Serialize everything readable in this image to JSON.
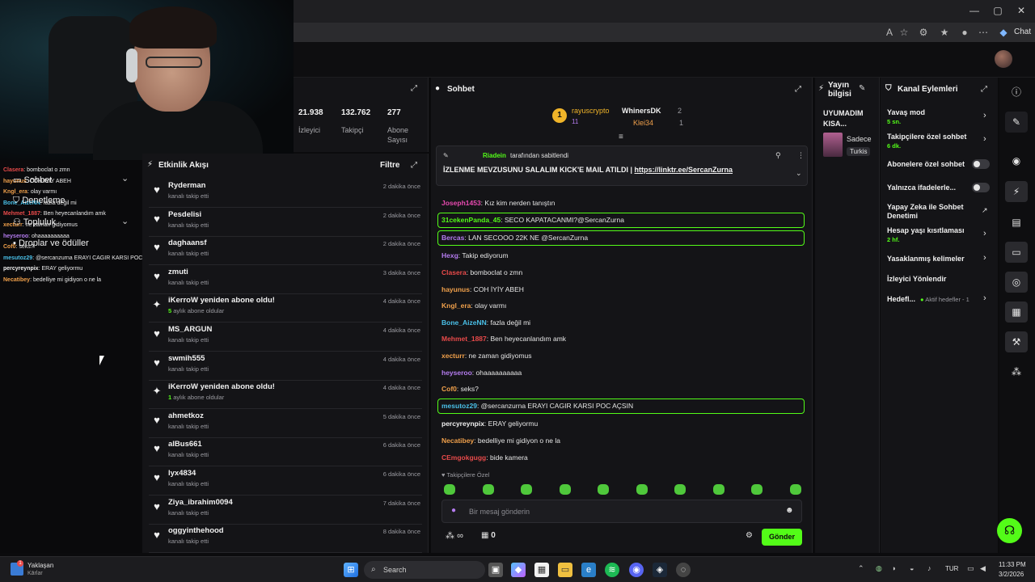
{
  "browser": {
    "copilot": "Chat",
    "window_controls": [
      "—",
      "▢",
      "✕"
    ]
  },
  "left_overlay": {
    "chat": [
      {
        "nick": "Clasera",
        "text": ": bomboclat o zmn",
        "color": "#e84a4a"
      },
      {
        "nick": "hayunus",
        "text": ": COH IYIY ABEH",
        "color": "#f0a04b"
      },
      {
        "nick": "Kngl_era",
        "text": ": olay varmı",
        "color": "#f0a04b"
      },
      {
        "nick": "Bone_AizeNN",
        "text": ": fazla değil mi",
        "color": "#4ac0e8"
      },
      {
        "nick": "Mehmet_1887",
        "text": ": Ben heyecanlandım amk",
        "color": "#e84a4a"
      },
      {
        "nick": "xecturr",
        "text": ": ne zaman gidiyomus",
        "color": "#f0a04b"
      },
      {
        "nick": "heyseroo",
        "text": ": ohaaaaaaaaaa",
        "color": "#b57cf0"
      },
      {
        "nick": "Cof0",
        "text": ": seks?",
        "color": "#f0a04b"
      },
      {
        "nick": "mesutoz29",
        "text": ": @sercanzurna ERAYI CAGIR KARSI POC AÇSIN",
        "color": "#4ac0e8"
      },
      {
        "nick": "percyreynpix",
        "text": ": ERAY geliyormu",
        "color": "#f0f0f0"
      },
      {
        "nick": "Necatibey",
        "text": ": bedelliye mi gidiyon o ne la",
        "color": "#f0a04b"
      }
    ],
    "nav": {
      "item1": "Sohbet",
      "item2": "Denetleme",
      "item3": "Topluluk",
      "item4": "Droplar ve ödüller"
    }
  },
  "stats": {
    "viewers_value": "21.938",
    "viewers_label": "İzleyici",
    "followers_value": "132.762",
    "followers_label": "Takipçi",
    "subs_value": "277",
    "subs_label": "Abone Sayısı"
  },
  "activity": {
    "title": "Etkinlik Akışı",
    "filter": "Filtre",
    "rows": [
      {
        "icon": "heart-icon",
        "glyph": "♥",
        "name": "Ryderman",
        "sub": "kanalı takip etti",
        "bold": "",
        "time": "2 dakika önce"
      },
      {
        "icon": "heart-icon",
        "glyph": "♥",
        "name": "Pesdelisi",
        "sub": "kanalı takip etti",
        "bold": "",
        "time": "2 dakika önce"
      },
      {
        "icon": "heart-icon",
        "glyph": "♥",
        "name": "daghaansf",
        "sub": "kanalı takip etti",
        "bold": "",
        "time": "2 dakika önce"
      },
      {
        "icon": "heart-icon",
        "glyph": "♥",
        "name": "zmuti",
        "sub": "kanalı takip etti",
        "bold": "",
        "time": "3 dakika önce"
      },
      {
        "icon": "sparkle-icon",
        "glyph": "✦",
        "name": "iKerroW yeniden abone oldu!",
        "sub": " aylık abone oldular",
        "bold": "5",
        "time": "4 dakika önce"
      },
      {
        "icon": "heart-icon",
        "glyph": "♥",
        "name": "MS_ARGUN",
        "sub": "kanalı takip etti",
        "bold": "",
        "time": "4 dakika önce"
      },
      {
        "icon": "heart-icon",
        "glyph": "♥",
        "name": "swmih555",
        "sub": "kanalı takip etti",
        "bold": "",
        "time": "4 dakika önce"
      },
      {
        "icon": "sparkle-icon",
        "glyph": "✦",
        "name": "iKerroW yeniden abone oldu!",
        "sub": " aylık abone oldular",
        "bold": "1",
        "time": "4 dakika önce"
      },
      {
        "icon": "heart-icon",
        "glyph": "♥",
        "name": "ahmetkoz",
        "sub": "kanalı takip etti",
        "bold": "",
        "time": "5 dakika önce"
      },
      {
        "icon": "heart-icon",
        "glyph": "♥",
        "name": "alBus661",
        "sub": "kanalı takip etti",
        "bold": "",
        "time": "6 dakika önce"
      },
      {
        "icon": "heart-icon",
        "glyph": "♥",
        "name": "lyx4834",
        "sub": "kanalı takip etti",
        "bold": "",
        "time": "6 dakika önce"
      },
      {
        "icon": "heart-icon",
        "glyph": "♥",
        "name": "Ziya_ibrahim0094",
        "sub": "kanalı takip etti",
        "bold": "",
        "time": "7 dakika önce"
      },
      {
        "icon": "heart-icon",
        "glyph": "♥",
        "name": "oggyinthehood",
        "sub": "kanalı takip etti",
        "bold": "",
        "time": "8 dakika önce"
      }
    ]
  },
  "chat": {
    "title": "Sohbet",
    "leaderboard": {
      "first_name": "rayuscrypto",
      "first_count": "11",
      "second_name": "WhinersDK",
      "second_count": "2",
      "third_name": "Klei34",
      "third_count": "1"
    },
    "pinned": {
      "by": "Riadein",
      "by_suffix": "tarafından sabitlendi",
      "text": "İZLENME MEVZUSUNU SALALIM KICK'E MAIL ATILDI | ",
      "link": "https://linktr.ee/SercanZurna"
    },
    "messages": [
      {
        "nick": "Joseph1453",
        "text": ": Kız kim nerden tanıştın",
        "color": "#e84ab0",
        "hl": false
      },
      {
        "nick": "31cekenPanda_45",
        "text": ": SECO KAPATACANMI?@SercanZurna",
        "color": "#53fc18",
        "hl": true
      },
      {
        "nick": "Bercas",
        "text": ": LAN SECOOO 22K NE @SercanZurna",
        "color": "#b57cf0",
        "hl": true
      },
      {
        "nick": "Hexg",
        "text": ": Takip ediyorum",
        "color": "#b57cf0",
        "hl": false
      },
      {
        "nick": "Clasera",
        "text": ": bomboclat o zmn",
        "color": "#e84a4a",
        "hl": false
      },
      {
        "nick": "hayunus",
        "text": ": COH İYİY ABEH",
        "color": "#f0a04b",
        "hl": false
      },
      {
        "nick": "Kngl_era",
        "text": ": olay varmı",
        "color": "#f0a04b",
        "hl": false
      },
      {
        "nick": "Bone_AizeNN",
        "text": ": fazla değil mi",
        "color": "#4ac0e8",
        "hl": false
      },
      {
        "nick": "Mehmet_1887",
        "text": ": Ben heyecanlandım amk",
        "color": "#e84a4a",
        "hl": false
      },
      {
        "nick": "xecturr",
        "text": ": ne zaman gidiyomus",
        "color": "#f0a04b",
        "hl": false
      },
      {
        "nick": "heyseroo",
        "text": ": ohaaaaaaaaaa",
        "color": "#b57cf0",
        "hl": false
      },
      {
        "nick": "Cof0",
        "text": ": seks?",
        "color": "#f0a04b",
        "hl": false
      },
      {
        "nick": "mesutoz29",
        "text": ": @sercanzurna ERAYI CAGIR KARSI POC AÇSIN",
        "color": "#4ac0e8",
        "hl": true
      },
      {
        "nick": "percyreynpix",
        "text": ": ERAY geliyormu",
        "color": "#f0f0f0",
        "hl": false
      },
      {
        "nick": "Necatibey",
        "text": ": bedelliye mi gidiyon o ne la",
        "color": "#f0a04b",
        "hl": false
      },
      {
        "nick": "CEmgokgugg",
        "text": ": bide kamera",
        "color": "#e84a4a",
        "hl": false
      }
    ],
    "followers_only": "Takipçilere Özel",
    "input_placeholder": "Bir mesaj gönderin",
    "infinity": "∞",
    "gift_count": "0",
    "send": "Gönder"
  },
  "stream_info": {
    "title": "Yayın bilgisi",
    "stream_title": "UYUMADIM KISA...",
    "category_name": "Sadece",
    "language": "Turkis"
  },
  "channel_actions": {
    "title": "Kanal Eylemleri",
    "slow_mode": "Yavaş mod",
    "slow_mode_value": "5 sn.",
    "followers_chat": "Takipçilere özel sohbet",
    "followers_chat_value": "6 dk.",
    "subscribers_chat": "Abonelere özel sohbet",
    "emote_only": "Yalnızca ifadelerle...",
    "ai_moderation": "Yapay Zeka ile Sohbet Denetimi",
    "account_age": "Hesap yaşı kısıtlaması",
    "account_age_value": "2 hf.",
    "banned_words": "Yasaklanmış kelimeler",
    "redirect": "İzleyici Yönlendir",
    "goals": "Hedefl...",
    "goals_value": "Aktif hedefler - 1"
  },
  "taskbar": {
    "weather_title": "Yaklaşan",
    "weather_sub": "Kārlar",
    "weather_badge": "1",
    "search": "Search",
    "lang": "TUR",
    "time": "11:33 PM",
    "date": "3/2/2026"
  },
  "colors": {
    "accent": "#53fc18",
    "panel": "#141417",
    "background": "#0b0b0d"
  }
}
